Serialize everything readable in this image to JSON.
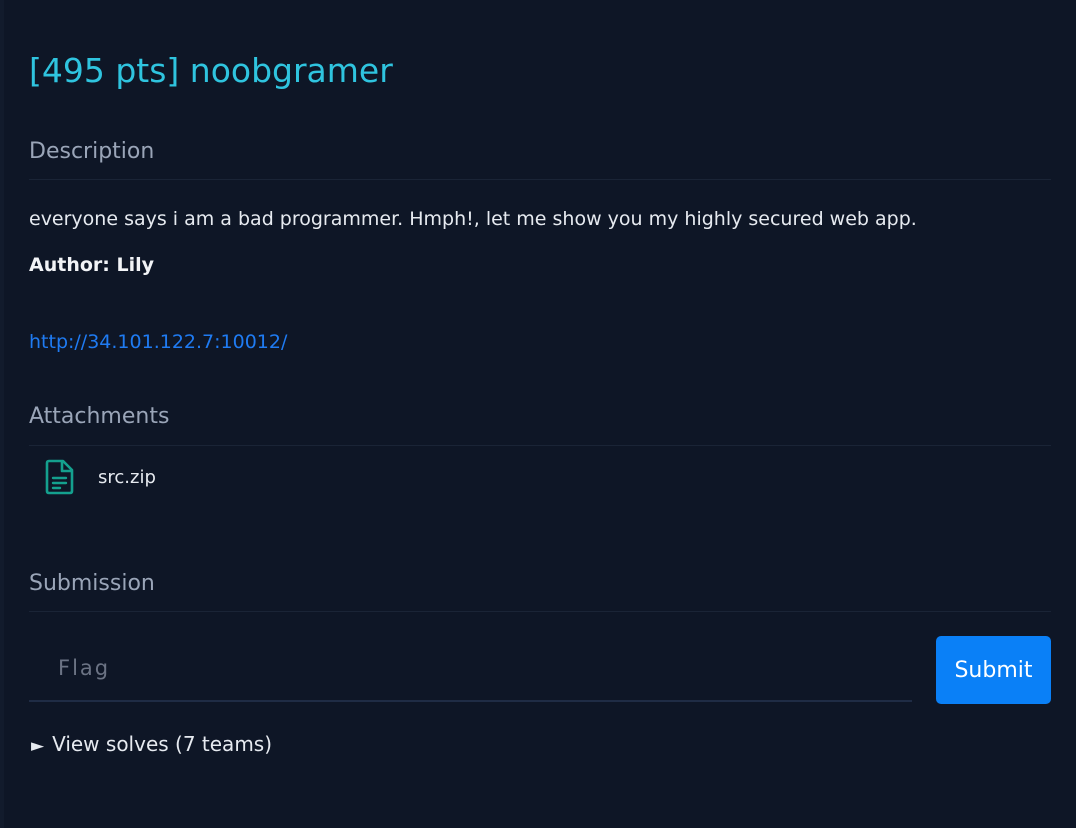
{
  "challenge": {
    "title": "[495 pts] noobgramer"
  },
  "description": {
    "heading": "Description",
    "text": "everyone says i am a bad programmer. Hmph!, let me show you my highly secured web app.",
    "author": "Author: Lily",
    "link": "http://34.101.122.7:10012/"
  },
  "attachments": {
    "heading": "Attachments",
    "files": [
      {
        "name": "src.zip",
        "icon": "file-document-icon",
        "icon_color": "#14a08e"
      }
    ]
  },
  "submission": {
    "heading": "Submission",
    "flag_placeholder": "Flag",
    "submit_label": "Submit",
    "view_solves_icon": "triangle-right-icon",
    "view_solves_glyph": "►",
    "view_solves_label": "View solves (7 teams)"
  },
  "colors": {
    "background": "#0e1626",
    "title": "#2fc4df",
    "heading": "#9aa5b8",
    "link": "#1f7bf2",
    "submit_button": "#0a80f7"
  }
}
